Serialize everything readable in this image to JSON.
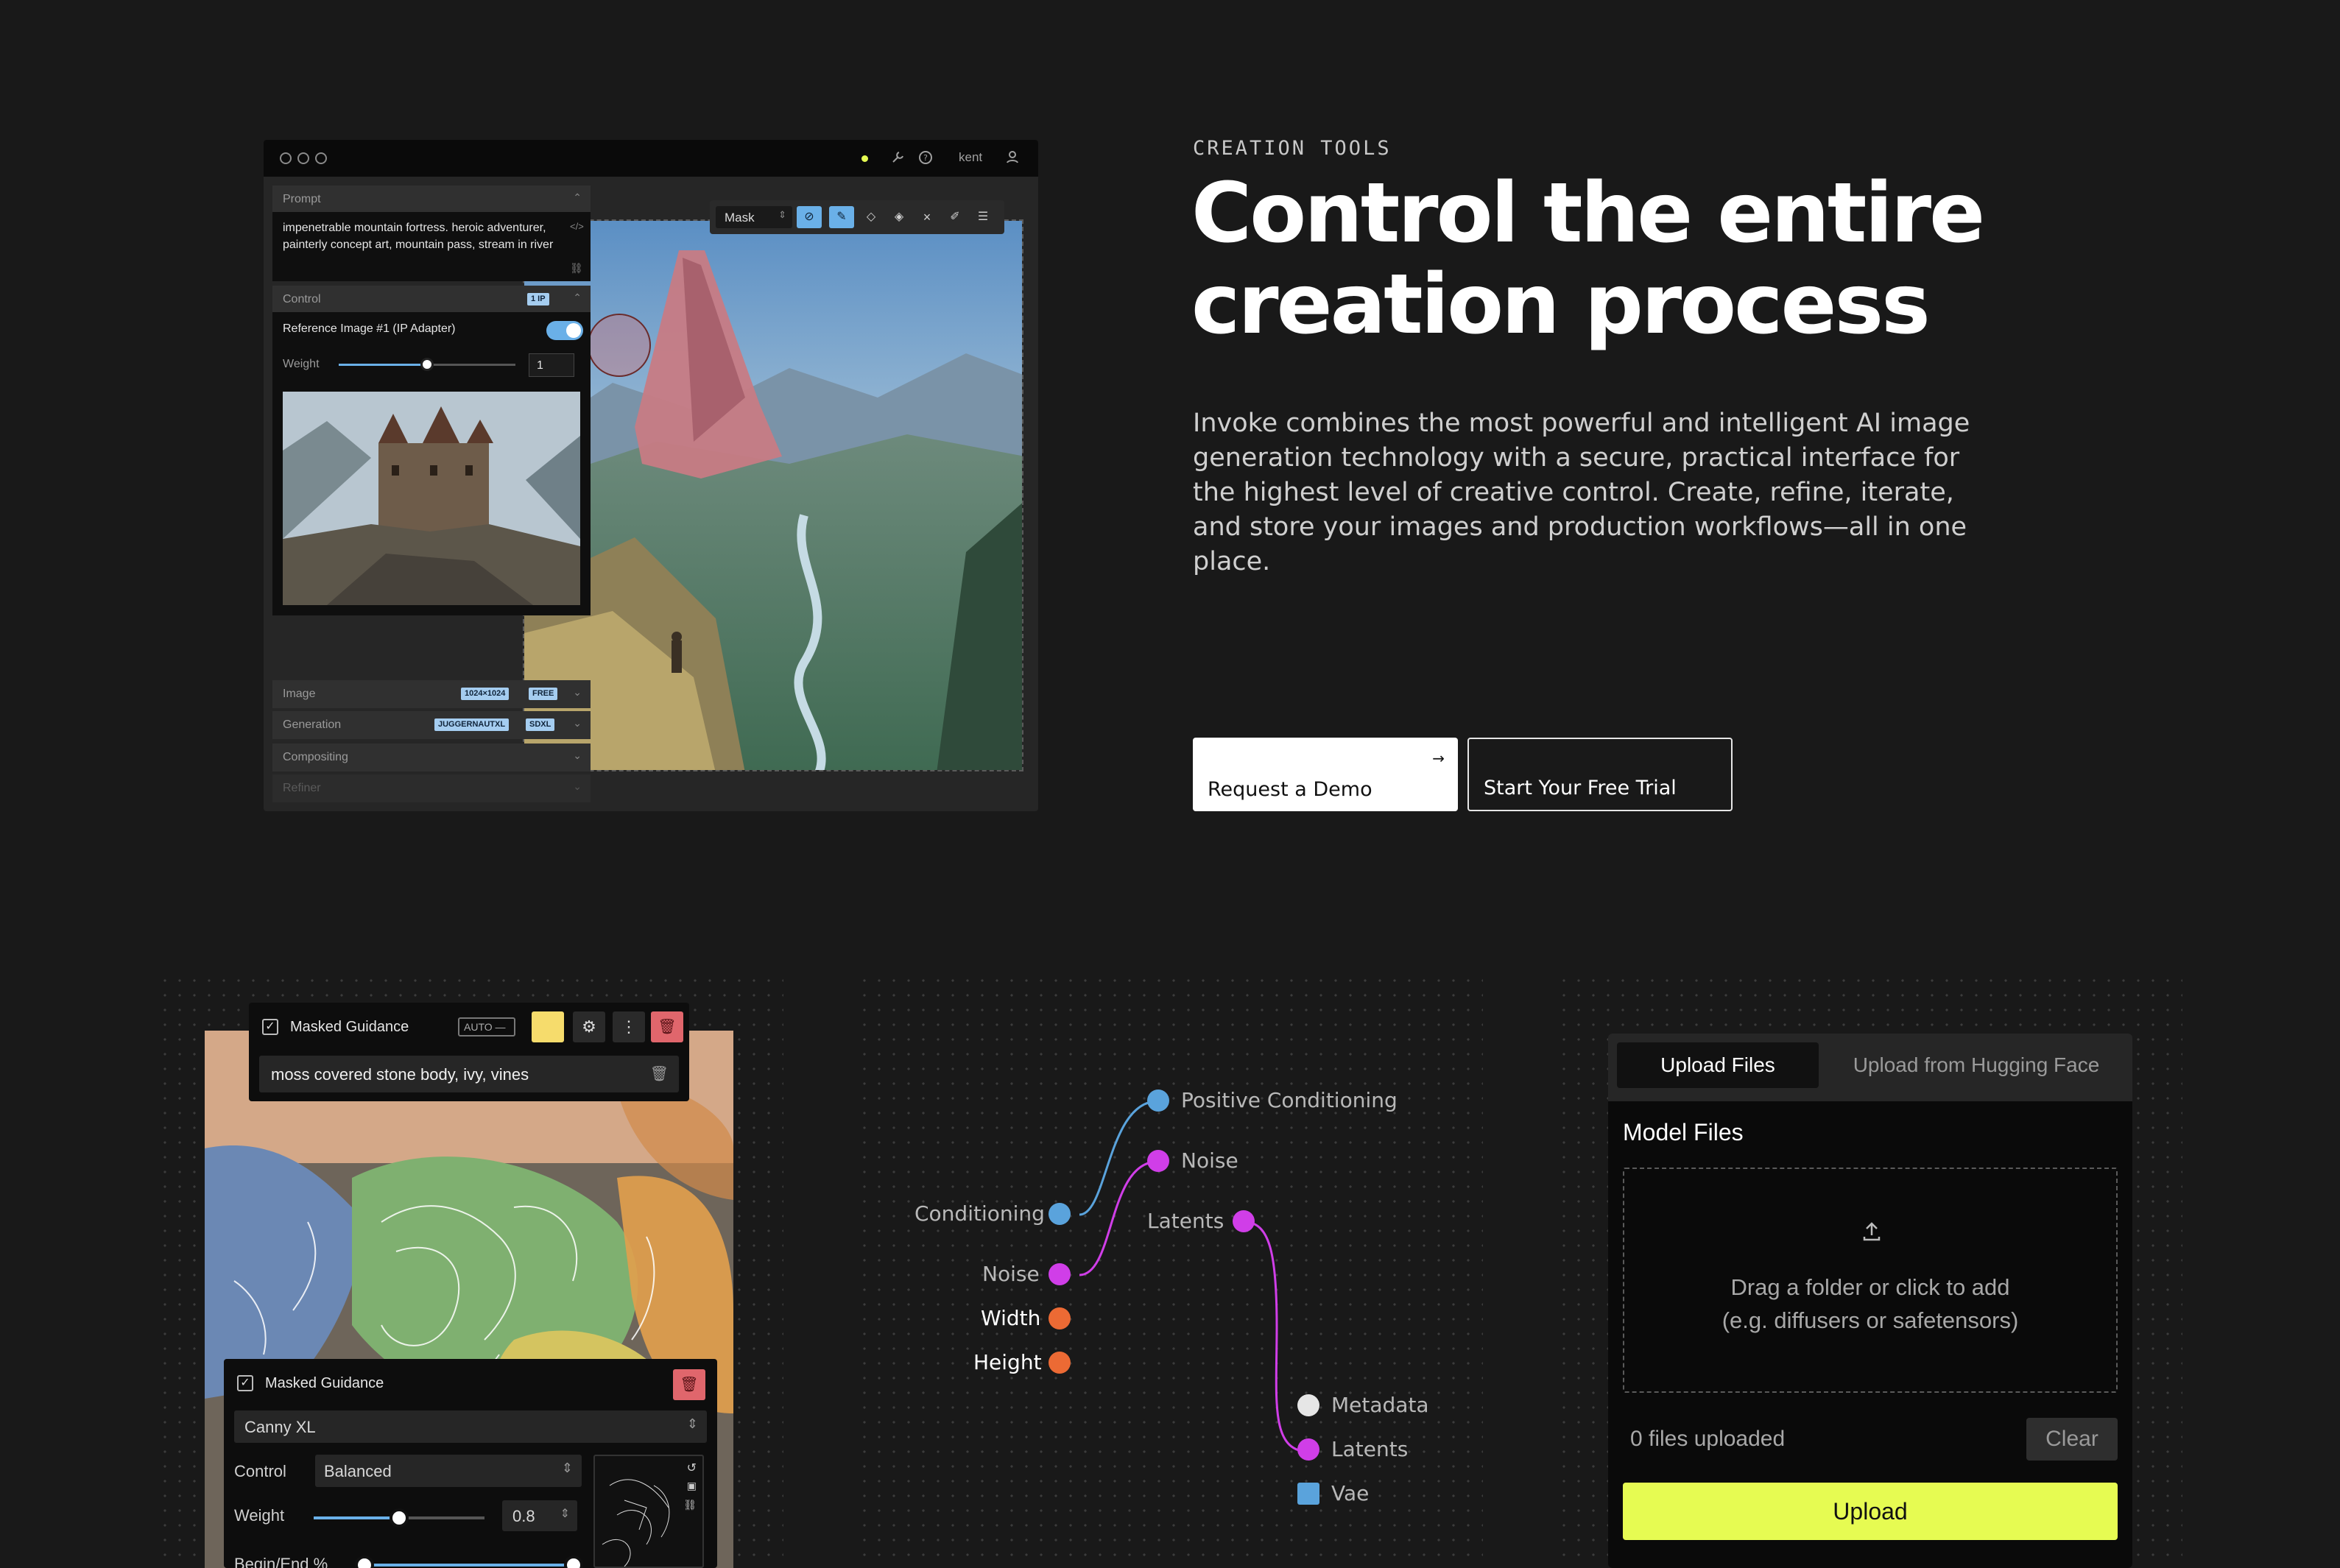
{
  "hero": {
    "eyebrow": "CREATION TOOLS",
    "headline_line1": "Control the entire",
    "headline_line2": "creation process",
    "lead": "Invoke combines the most powerful and intelligent AI image generation technology with a secure, practical interface for the highest level of creative control. Create, refine, iterate, and store your images and production workflows—all in one place.",
    "cta_demo": "Request a Demo",
    "cta_trial": "Start Your Free Trial"
  },
  "app": {
    "user": "kent",
    "prompt_header": "Prompt",
    "prompt_text": "impenetrable mountain fortress. heroic adventurer, painterly concept art, mountain pass, stream in river",
    "control_header": "Control",
    "control_badge": "1 IP",
    "reference_label": "Reference Image #1 (IP Adapter)",
    "weight_label": "Weight",
    "weight_value": "1",
    "weight_fraction": 0.5,
    "mask_select": "Mask",
    "image_header": "Image",
    "image_badges": [
      "1024×1024",
      "FREE"
    ],
    "generation_header": "Generation",
    "generation_badges": [
      "JUGGERNAUTXL",
      "SDXL"
    ],
    "compositing_header": "Compositing",
    "refiner_header": "Refiner"
  },
  "masked": {
    "title": "Masked Guidance",
    "auto_label": "AUTO",
    "prompt": "moss covered stone body, ivy, vines",
    "accent_color": "#f6dc6c",
    "title2": "Masked Guidance",
    "model": "Canny XL",
    "control_label": "Control",
    "control_value": "Balanced",
    "weight_label": "Weight",
    "weight_value": "0.8",
    "weight_fraction": 0.5,
    "beginend_label": "Begin/End %"
  },
  "graph": {
    "inputs": [
      {
        "label": "Conditioning",
        "color": "#5aa3dc"
      },
      {
        "label": "Noise",
        "color": "#d03ee8"
      },
      {
        "label": "Width",
        "color": "#ec6a34"
      },
      {
        "label": "Height",
        "color": "#ec6a34"
      }
    ],
    "mid_outputs": [
      {
        "label": "Positive Conditioning",
        "color": "#5aa3dc"
      },
      {
        "label": "Noise",
        "color": "#d03ee8"
      },
      {
        "label": "Latents",
        "color": "#d03ee8"
      }
    ],
    "final": [
      {
        "label": "Metadata",
        "color": "#e6e6e6"
      },
      {
        "label": "Latents",
        "color": "#d03ee8"
      },
      {
        "label": "Vae",
        "color": "#5aa3dc"
      }
    ]
  },
  "upload": {
    "tab_active": "Upload Files",
    "tab_other": "Upload from Hugging Face",
    "section_title": "Model Files",
    "drop_line1": "Drag a folder or click to add",
    "drop_line2": "(e.g. diffusers or safetensors)",
    "count_text": "0 files uploaded",
    "clear_label": "Clear",
    "upload_label": "Upload",
    "accent_color": "#e6fb52"
  }
}
